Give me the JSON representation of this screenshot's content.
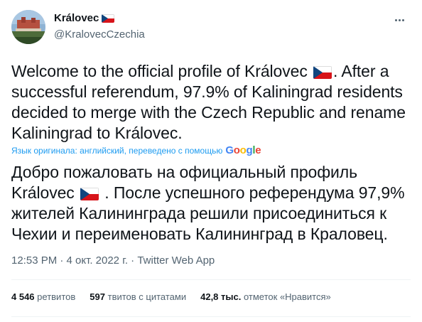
{
  "colors": {
    "accent": "#1d9bf0",
    "text": "#0f1419",
    "secondary": "#536471",
    "flag_red": "#d7141a",
    "flag_blue": "#11457e"
  },
  "user": {
    "display_name": "Královec",
    "handle": "@KralovecCzechia",
    "flag_icon": "czech-flag-icon"
  },
  "tweet": {
    "text_before_flag": "Welcome to the official profile of Královec ",
    "text_after_flag": ". After a successful referendum, 97.9% of Kaliningrad residents decided to merge with the Czech Republic and rename Kaliningrad to Královec.",
    "translation_note": "Язык оригинала: английский, переведено с помощью",
    "translation_provider": "Google",
    "translated_before_flag": "Добро пожаловать на официальный профиль Královec ",
    "translated_after_flag": " . После успешного референдума 97,9% жителей Калининграда решили присоединиться к Чехии и переименовать Калининград в Краловец.",
    "timestamp": "12:53 PM · 4 окт. 2022 г. · Twitter Web App"
  },
  "stats": {
    "retweets_count": "4 546",
    "retweets_label": "ретвитов",
    "quotes_count": "597",
    "quotes_label": "твитов с цитатами",
    "likes_count": "42,8 тыс.",
    "likes_label": "отметок «Нравится»"
  }
}
